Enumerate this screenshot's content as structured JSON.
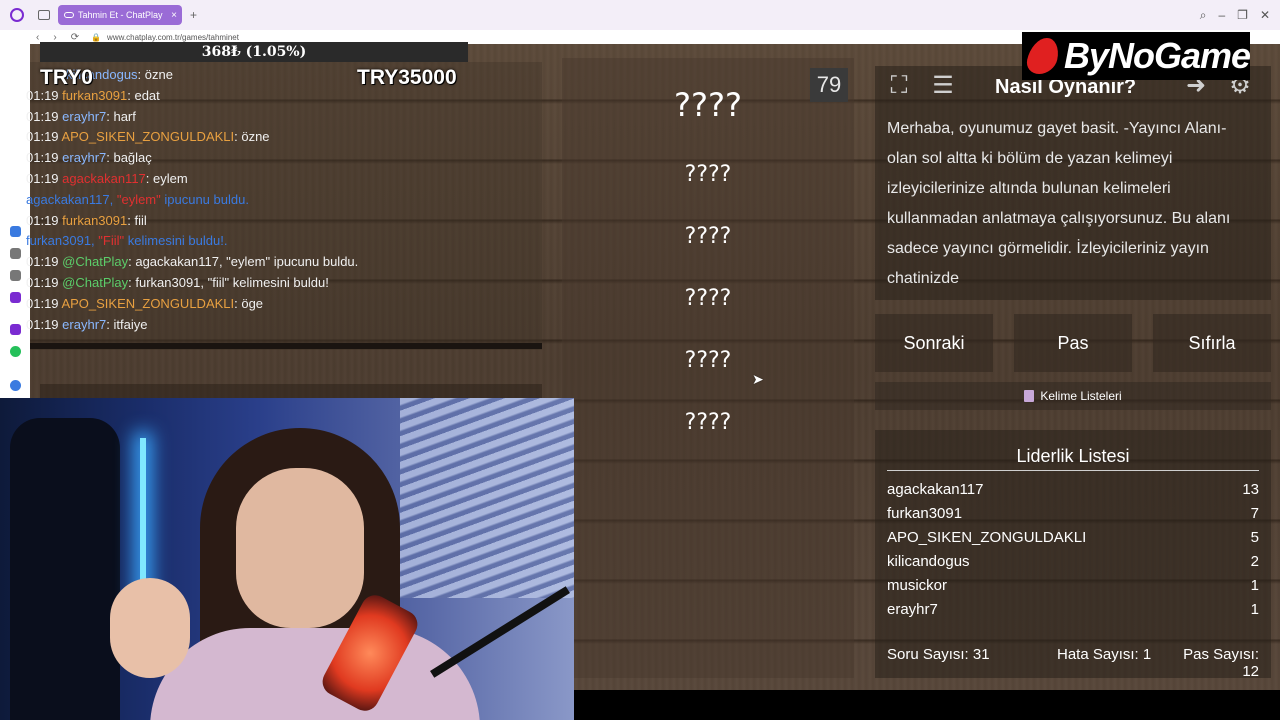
{
  "browser": {
    "tab_title": "Tahmin Et - ChatPlay",
    "tab_close": "×",
    "new_tab": "+",
    "url": "www.chatplay.com.tr/games/tahminet",
    "nav_back": "‹",
    "nav_forward": "›",
    "nav_reload": "⟳",
    "lock": "🔒",
    "win_search": "⌕",
    "win_min": "–",
    "win_max": "❐",
    "win_close": "✕"
  },
  "overlay": {
    "percent": "368₺ (1.05%)",
    "try_left": "TRY0",
    "try_right": "TRY35000",
    "brand": "ByNoGame"
  },
  "chat": {
    "lines": [
      {
        "time": "",
        "user": "kilicandogus",
        "user_color": "blue",
        "text": ": özne"
      },
      {
        "time": "01:19",
        "user": "furkan3091",
        "user_color": "orange",
        "text": ": edat"
      },
      {
        "time": "01:19",
        "user": "erayhr7",
        "user_color": "blue",
        "text": ": harf"
      },
      {
        "time": "01:19",
        "user": "APO_SIKEN_ZONGULDAKLI",
        "user_color": "orange",
        "text": ": özne"
      },
      {
        "time": "01:19",
        "user": "erayhr7",
        "user_color": "blue",
        "text": ": bağlaç"
      },
      {
        "time": "01:19",
        "user": "agackakan117",
        "user_color": "red",
        "text": ": eylem"
      },
      {
        "notice_user": "agackakan117,",
        "notice_hl": "\"eylem\"",
        "notice_text": " ipucunu buldu."
      },
      {
        "time": "01:19",
        "user": "furkan3091",
        "user_color": "orange",
        "text": ": fiil"
      },
      {
        "notice_user": "furkan3091,",
        "notice_hl": "\"Fiil\"",
        "notice_text": " kelimesini buldu!."
      },
      {
        "time": "01:19",
        "user": "@ChatPlay",
        "user_color": "green",
        "text": ": agackakan117, \"eylem\" ipucunu buldu."
      },
      {
        "time": "01:19",
        "user": "@ChatPlay",
        "user_color": "green",
        "text": ": furkan3091, \"fiil\" kelimesini buldu!"
      },
      {
        "time": "01:19",
        "user": "APO_SIKEN_ZONGULDAKLI",
        "user_color": "orange",
        "text": ": öge"
      },
      {
        "time": "01:19",
        "user": "erayhr7",
        "user_color": "blue",
        "text": ": itfaiye"
      }
    ]
  },
  "words": {
    "count": "79",
    "main": "????",
    "items": [
      "????",
      "????",
      "????",
      "????",
      "????"
    ]
  },
  "howto": {
    "title": "Nasıl Oynanır?",
    "text": "Merhaba, oyunumuz gayet basit. -Yayıncı Alanı- olan sol altta ki bölüm de yazan kelimeyi izleyicilerinize altında bulunan kelimeleri kullanmadan anlatmaya çalışıyorsunuz. Bu alanı sadece yayıncı görmelidir. İzleyicileriniz yayın chatinizde"
  },
  "actions": {
    "next": "Sonraki",
    "pass": "Pas",
    "reset": "Sıfırla",
    "word_lists": "Kelime Listeleri"
  },
  "leaderboard": {
    "title": "Liderlik Listesi",
    "rows": [
      {
        "name": "agackakan117",
        "score": "13"
      },
      {
        "name": "furkan3091",
        "score": "7"
      },
      {
        "name": "APO_SIKEN_ZONGULDAKLI",
        "score": "5"
      },
      {
        "name": "kilicandogus",
        "score": "2"
      },
      {
        "name": "musickor",
        "score": "1"
      },
      {
        "name": "erayhr7",
        "score": "1"
      }
    ],
    "questions": "Soru Sayısı: 31",
    "errors": "Hata Sayısı: 1",
    "passes": "Pas Sayısı: 12"
  },
  "colors": {
    "blue": "#8ab8ff",
    "orange": "#e8a040",
    "red": "#e03030",
    "green": "#5ccd6a",
    "notice": "#3a7ae0",
    "tab": "#9a6bd6"
  }
}
